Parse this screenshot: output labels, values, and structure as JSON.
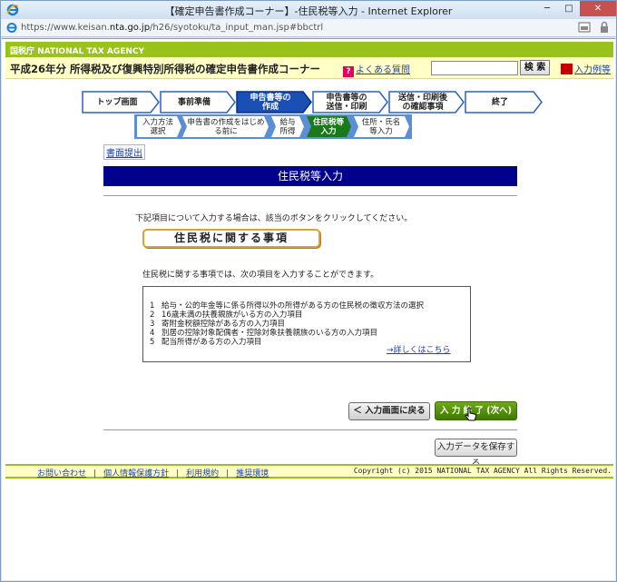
{
  "window": {
    "title": "【確定申告書作成コーナー】-住民税等入力 - Internet Explorer",
    "url_prefix": "https://www.keisan.",
    "url_domain": "nta.go.jp",
    "url_path": "/h26/syotoku/ta_input_man.jsp#bbctrl"
  },
  "header": {
    "agency": "国税庁  NATIONAL TAX AGENCY",
    "site_title": "平成26年分  所得税及び復興特別所得税の確定申告書作成コーナー",
    "faq_icon": "?",
    "faq_label": "よくある質問",
    "search_value": "",
    "search_button": "検 索",
    "guide_label": "入力例等"
  },
  "steps": [
    {
      "label": "トップ画面"
    },
    {
      "label": "事前準備"
    },
    {
      "label": "申告書等の\n作成"
    },
    {
      "label": "申告書等の\n送信・印刷"
    },
    {
      "label": "送信・印刷後\nの確認事項"
    },
    {
      "label": "終了"
    }
  ],
  "substeps": [
    {
      "label": "入力方法\n選択"
    },
    {
      "label": "申告書の作成をはじめ\nる前に"
    },
    {
      "label": "給与\n所得"
    },
    {
      "label": "住民税等\n入力"
    },
    {
      "label": "住所・氏名\n等入力"
    }
  ],
  "main": {
    "submit_link": "書面提出",
    "section_title": "住民税等入力",
    "instruction": "下記項目について入力する場合は、該当のボタンをクリックしてください。",
    "section_button": "住民税に関する事項",
    "description": "住民税に関する事項では、次の項目を入力することができます。",
    "items": [
      {
        "num": "1",
        "text": "給与・公的年金等に係る所得以外の所得がある方の住民税の徴収方法の選択"
      },
      {
        "num": "2",
        "text": "16歳未満の扶養親族がいる方の入力項目"
      },
      {
        "num": "3",
        "text": "寄附金税額控除がある方の入力項目"
      },
      {
        "num": "4",
        "text": "別居の控除対象配偶者・控除対象扶養親族のいる方の入力項目"
      },
      {
        "num": "5",
        "text": "配当所得がある方の入力項目"
      }
    ],
    "detail_link": "→詳しくはこちら",
    "back_button": "＜ 入力画面に戻る",
    "next_button": "入 力 終 了 (次へ) ＞",
    "save_button": "入力データを保存する"
  },
  "footer": {
    "links": [
      "お問い合わせ",
      "個人情報保護方針",
      "利用規約",
      "推奨環境"
    ],
    "copyright": "Copyright (c) 2015 NATIONAL TAX AGENCY All Rights Reserved."
  },
  "colors": {
    "agency_green": "#99c21b",
    "header_yellow": "#ffffc6",
    "section_navy": "#00008e",
    "active_step": "#1a4fb5",
    "next_green": "#3d7a00"
  }
}
